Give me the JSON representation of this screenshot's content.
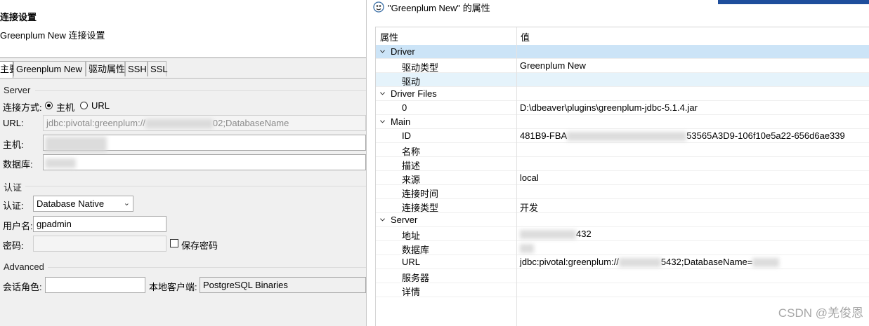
{
  "left": {
    "title": "连接设置",
    "subtitle": "Greenplum New 连接设置",
    "tabs": [
      "主要",
      "Greenplum New",
      "驱动属性",
      "SSH",
      "SSL"
    ],
    "server_group": {
      "title": "Server",
      "connect_mode_label": "连接方式:",
      "option_host": "主机",
      "option_url": "URL",
      "url_label": "URL:",
      "url_value": "jdbc:pivotal:greenplum://",
      "url_value_suffix": "02;DatabaseName",
      "host_label": "主机:",
      "database_label": "数据库:"
    },
    "auth_group": {
      "title": "认证",
      "auth_label": "认证:",
      "auth_value": "Database Native",
      "username_label": "用户名:",
      "username_value": "gpadmin",
      "password_label": "密码:",
      "save_password_label": "保存密码"
    },
    "advanced_group": {
      "title": "Advanced",
      "session_role_label": "会话角色:",
      "local_client_label": "本地客户端:",
      "local_client_value": "PostgreSQL Binaries"
    }
  },
  "right": {
    "window_title": "\"Greenplum New\" 的属性",
    "header": {
      "property": "属性",
      "value": "值"
    },
    "rows": [
      {
        "name": "Driver",
        "value": "",
        "level": 0,
        "expanded": true
      },
      {
        "name": "驱动类型",
        "value": "Greenplum New",
        "level": 1
      },
      {
        "name": "驱动",
        "value": "",
        "level": 1
      },
      {
        "name": "Driver Files",
        "value": "",
        "level": 0,
        "expanded": true
      },
      {
        "name": "0",
        "value": "D:\\dbeaver\\plugins\\greenplum-jdbc-5.1.4.jar",
        "level": 1
      },
      {
        "name": "Main",
        "value": "",
        "level": 0,
        "expanded": true
      },
      {
        "name": "ID",
        "value": "481B9-FBA",
        "value_tail": "53565A3D9-106f10e5a22-656d6ae339",
        "level": 1
      },
      {
        "name": "名称",
        "value": "",
        "level": 1
      },
      {
        "name": "描述",
        "value": "",
        "level": 1
      },
      {
        "name": "来源",
        "value": "local",
        "level": 1
      },
      {
        "name": "连接时间",
        "value": "",
        "level": 1
      },
      {
        "name": "连接类型",
        "value": "开发",
        "level": 1
      },
      {
        "name": "Server",
        "value": "",
        "level": 0,
        "expanded": true
      },
      {
        "name": "地址",
        "value": "",
        "value_tail": "432",
        "level": 1
      },
      {
        "name": "数据库",
        "value": "",
        "level": 1
      },
      {
        "name": "URL",
        "value": "jdbc:pivotal:greenplum://",
        "value_tail": "5432;DatabaseName=",
        "level": 1
      },
      {
        "name": "服务器",
        "value": "",
        "level": 1
      },
      {
        "name": "详情",
        "value": "",
        "level": 1
      }
    ],
    "selected_row": 0,
    "highlight_row": 2
  },
  "watermark": "CSDN @羌俊恩",
  "colors": {
    "selection": "#cce4f7",
    "hover": "#e5f3fb",
    "accent": "#1f4e9c"
  }
}
